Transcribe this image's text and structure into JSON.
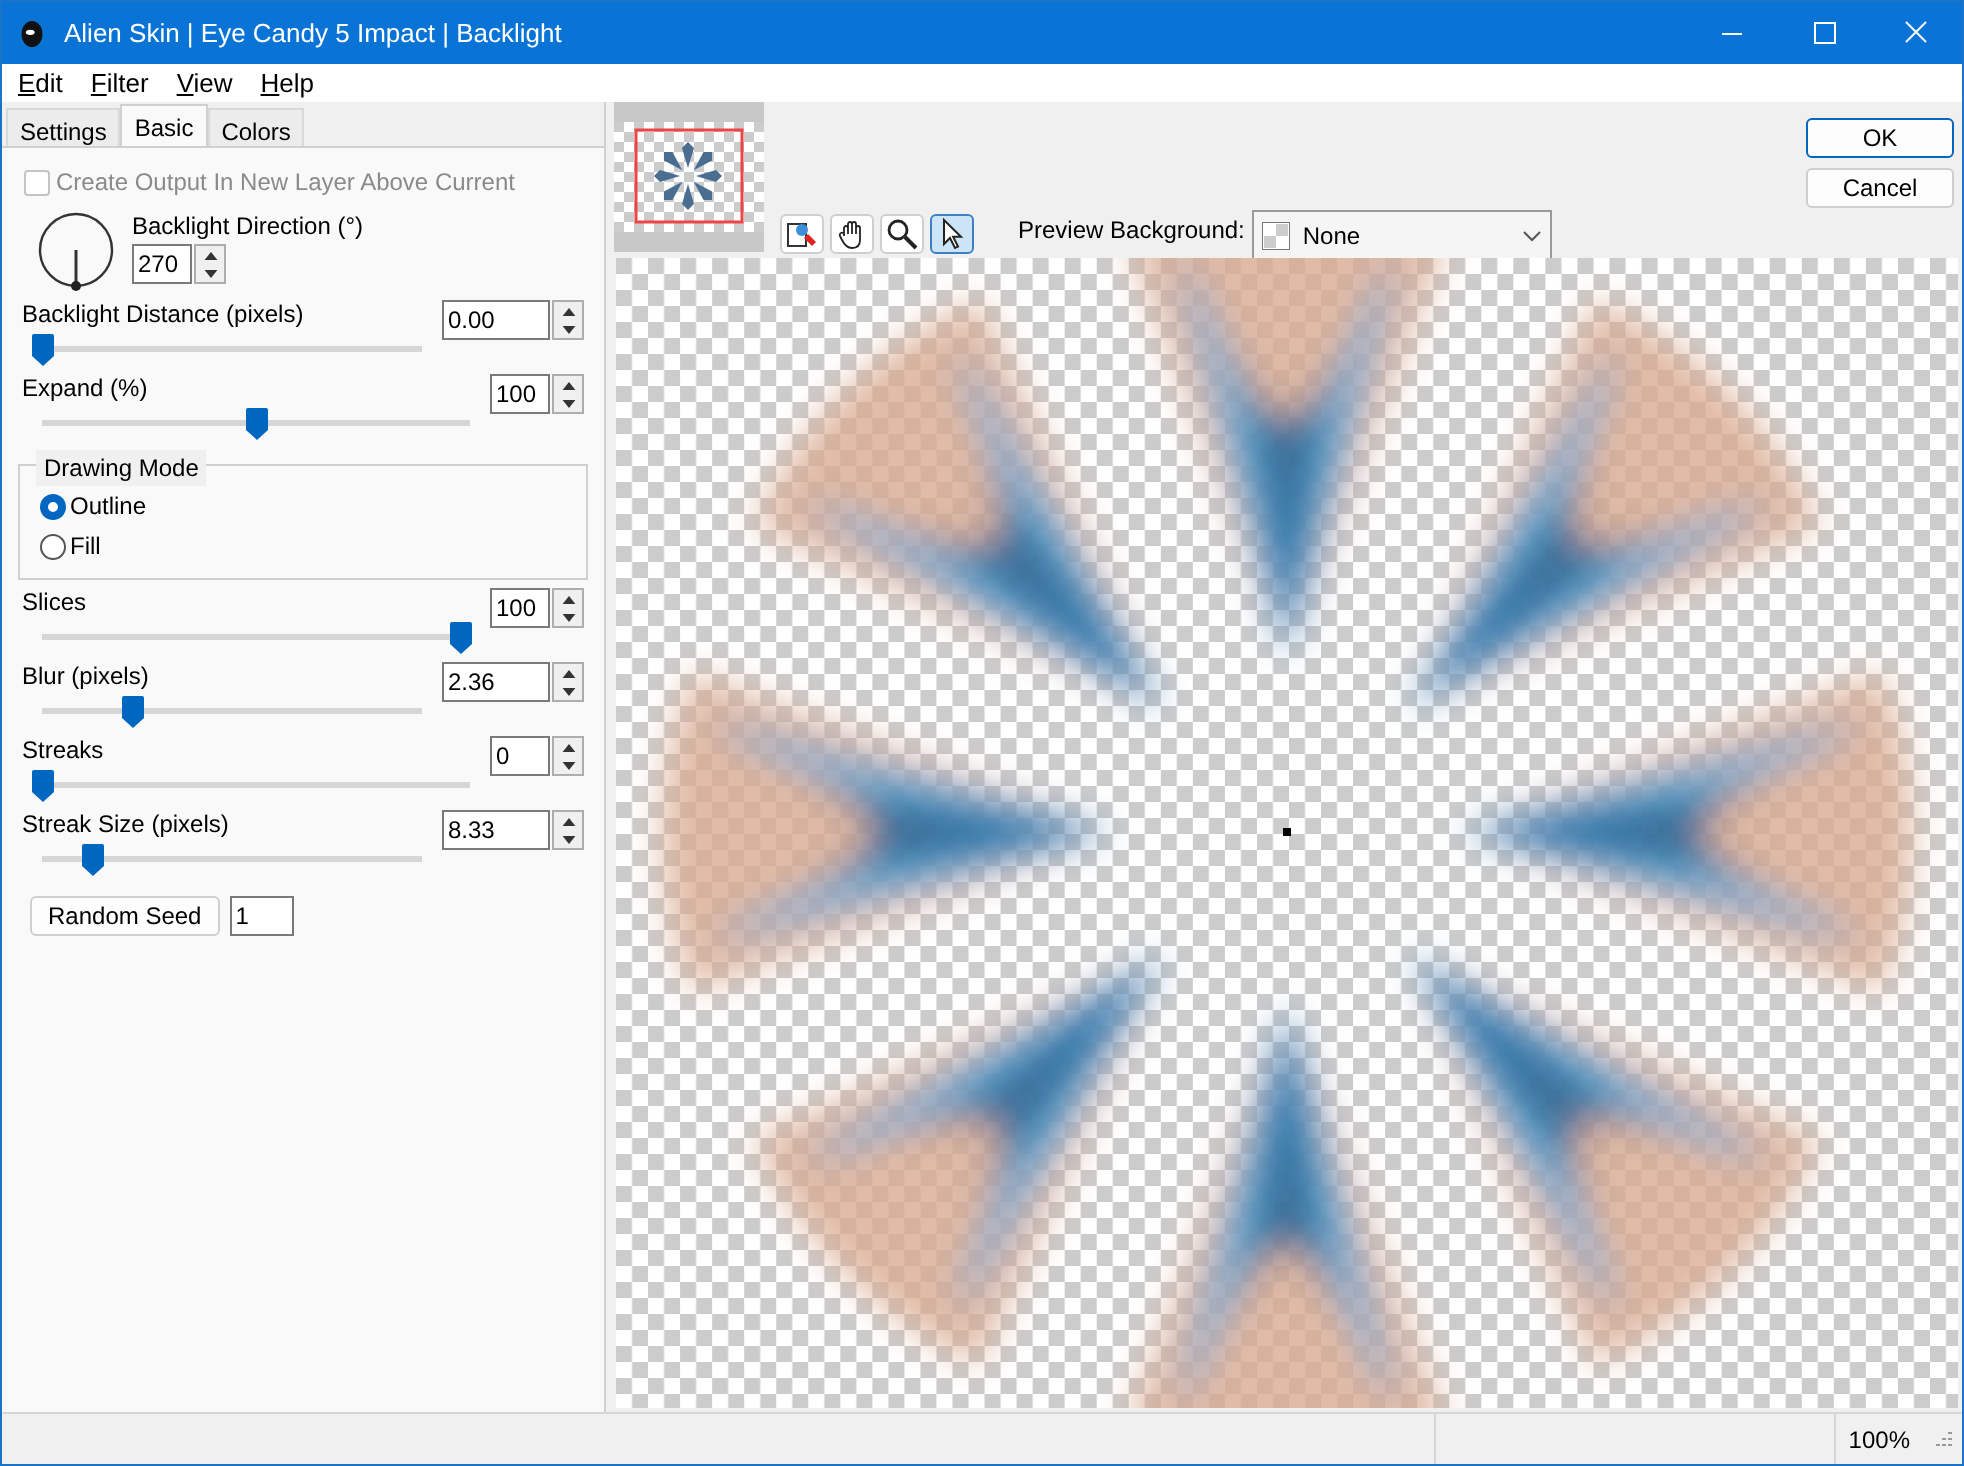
{
  "window": {
    "title": "Alien Skin | Eye Candy 5 Impact | Backlight"
  },
  "menu": [
    {
      "label": "Edit"
    },
    {
      "label": "Filter"
    },
    {
      "label": "View"
    },
    {
      "label": "Help"
    }
  ],
  "tabs": [
    {
      "label": "Settings",
      "selected": false
    },
    {
      "label": "Basic",
      "selected": true
    },
    {
      "label": "Colors",
      "selected": false
    }
  ],
  "create_output": {
    "label": "Create Output In New Layer Above Current",
    "checked": false,
    "disabled": true
  },
  "direction": {
    "label": "Backlight Direction (°)",
    "value": "270"
  },
  "controls": [
    {
      "kind": "slider",
      "label": "Backlight Distance (pixels)",
      "value": "0.00",
      "level": 0.0
    },
    {
      "kind": "slider",
      "label": "Expand (%)",
      "value": "100",
      "level": 0.5
    },
    {
      "kind": "group",
      "label": "Drawing Mode",
      "options": [
        {
          "label": "Outline",
          "selected": true
        },
        {
          "label": "Fill",
          "selected": false
        }
      ]
    },
    {
      "kind": "slider",
      "label": "Slices",
      "value": "100",
      "level": 0.98
    },
    {
      "kind": "slider",
      "label": "Blur (pixels)",
      "value": "2.36",
      "level": 0.24
    },
    {
      "kind": "slider",
      "label": "Streaks",
      "value": "0",
      "level": 0.0
    },
    {
      "kind": "slider",
      "label": "Streak Size (pixels)",
      "value": "8.33",
      "level": 0.13
    }
  ],
  "random_seed": {
    "label": "Random Seed",
    "value": "1"
  },
  "tools": [
    {
      "kind": "toggle",
      "selected": false
    },
    {
      "kind": "hand",
      "selected": false
    },
    {
      "kind": "zoom",
      "selected": false
    },
    {
      "kind": "pointer",
      "selected": true
    }
  ],
  "preview_background": {
    "label": "Preview Background:",
    "value": "None"
  },
  "buttons": [
    {
      "label": "OK",
      "default": true
    },
    {
      "label": "Cancel",
      "default": false
    }
  ],
  "status_bar": {
    "zoom": "100%"
  }
}
